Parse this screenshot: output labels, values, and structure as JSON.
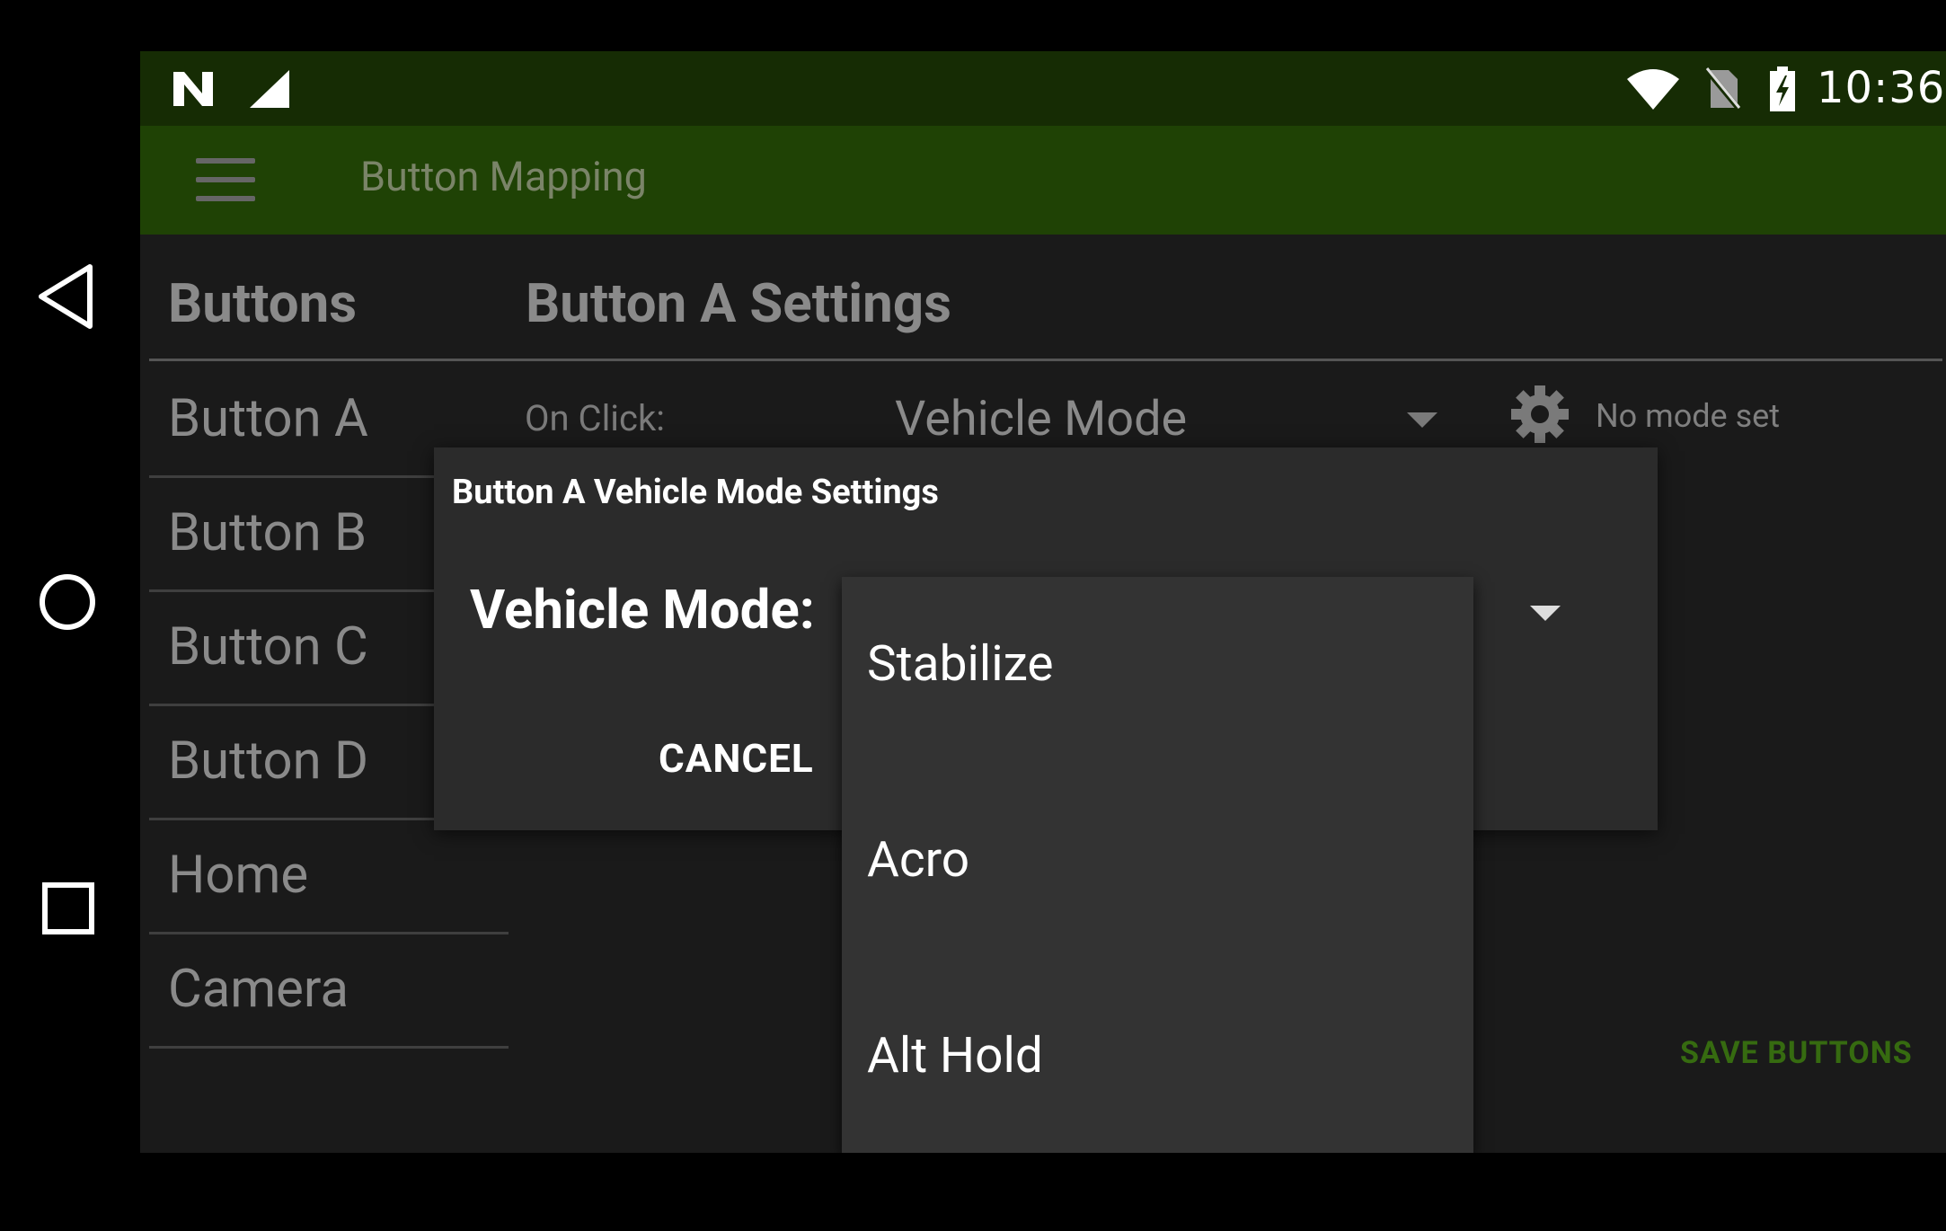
{
  "status_bar": {
    "time": "10:36",
    "icons": [
      "n-notification-icon",
      "cell-signal-icon",
      "wifi-icon",
      "no-sim-icon",
      "battery-charging-icon"
    ]
  },
  "app_bar": {
    "menu_icon": "hamburger-menu-icon",
    "title": "Button Mapping"
  },
  "sidebar": {
    "header": "Buttons",
    "items": [
      {
        "label": "Button A"
      },
      {
        "label": "Button B"
      },
      {
        "label": "Button C"
      },
      {
        "label": "Button D"
      },
      {
        "label": "Home"
      },
      {
        "label": "Camera"
      }
    ]
  },
  "settings": {
    "header": "Button A Settings",
    "on_click_label": "On Click:",
    "on_click_value": "Vehicle Mode",
    "gear_icon": "gear-icon",
    "mode_status": "No mode set",
    "save_label": "SAVE BUTTONS"
  },
  "dialog": {
    "title": "Button A Vehicle Mode Settings",
    "vehicle_mode_label": "Vehicle Mode:",
    "cancel_label": "CANCEL"
  },
  "dropdown": {
    "options": [
      "Stabilize",
      "Acro",
      "Alt Hold"
    ]
  },
  "navigation": {
    "icons": [
      "back-icon",
      "home-icon",
      "recents-icon"
    ]
  },
  "colors": {
    "status_bar": "#162c04",
    "app_bar": "#1f4205",
    "accent_green": "#366b10",
    "dialog_bg": "#2b2b2b",
    "dropdown_bg": "#333333"
  }
}
